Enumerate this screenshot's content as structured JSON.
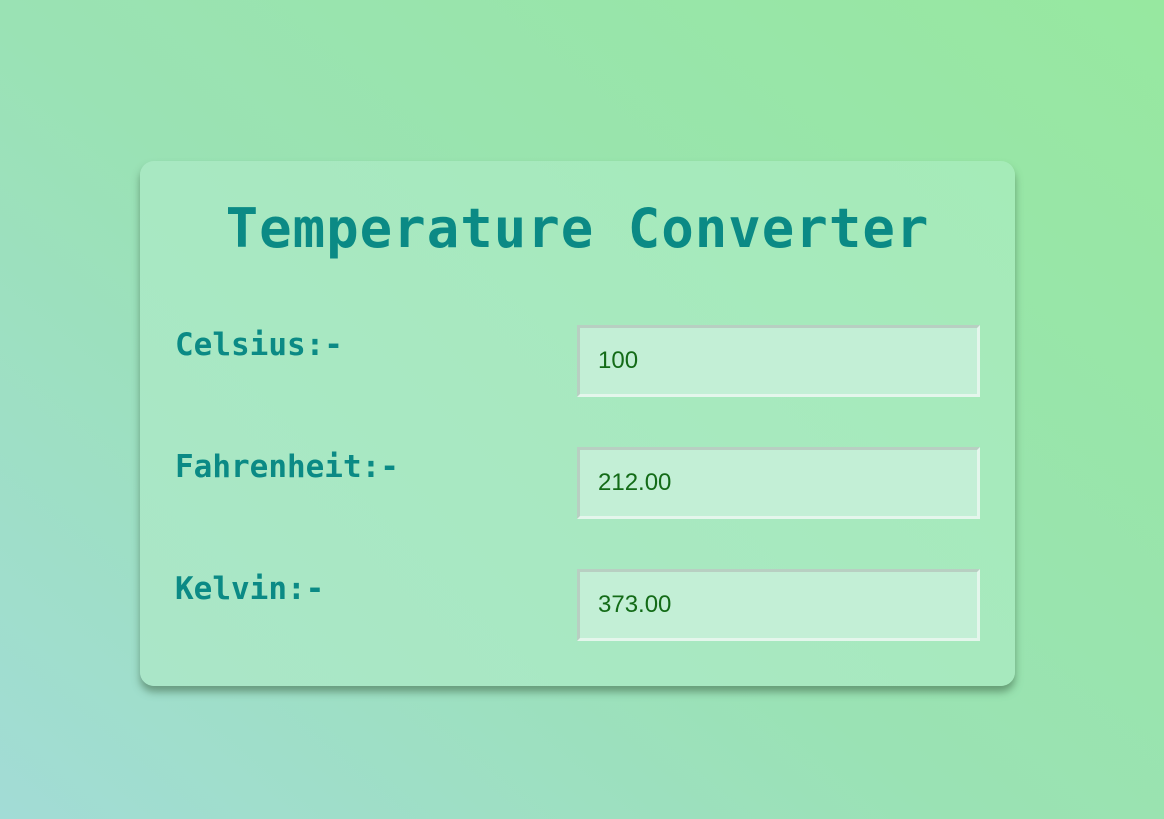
{
  "converter": {
    "title": "Temperature Converter",
    "fields": [
      {
        "label": "Celsius:-",
        "value": "100"
      },
      {
        "label": "Fahrenheit:-",
        "value": "212.00"
      },
      {
        "label": "Kelvin:-",
        "value": "373.00"
      }
    ]
  },
  "colors": {
    "accent": "#0b8a85",
    "input_text": "#136b17",
    "input_background": "#c3efd6"
  }
}
